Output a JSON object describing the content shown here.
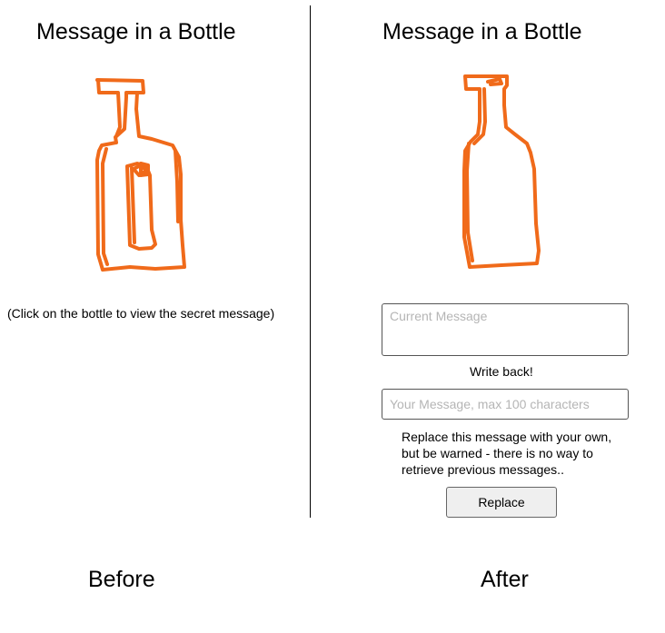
{
  "before": {
    "title": "Message in a Bottle",
    "hint": "(Click on the bottle to view the secret message)",
    "caption": "Before"
  },
  "after": {
    "title": "Message in a Bottle",
    "current_message": {
      "value": "",
      "placeholder": "Current Message"
    },
    "write_back_label": "Write back!",
    "reply": {
      "value": "",
      "placeholder": "Your Message, max 100 characters"
    },
    "warning": "Replace this message with your own, but be warned - there is no way to retrieve previous messages..",
    "replace_button": "Replace",
    "caption": "After"
  },
  "colors": {
    "bottle_stroke": "#f06a1a",
    "divider": "#000000"
  },
  "icons": {
    "bottle_with_scroll": "bottle-with-message-icon",
    "empty_bottle": "bottle-icon"
  }
}
